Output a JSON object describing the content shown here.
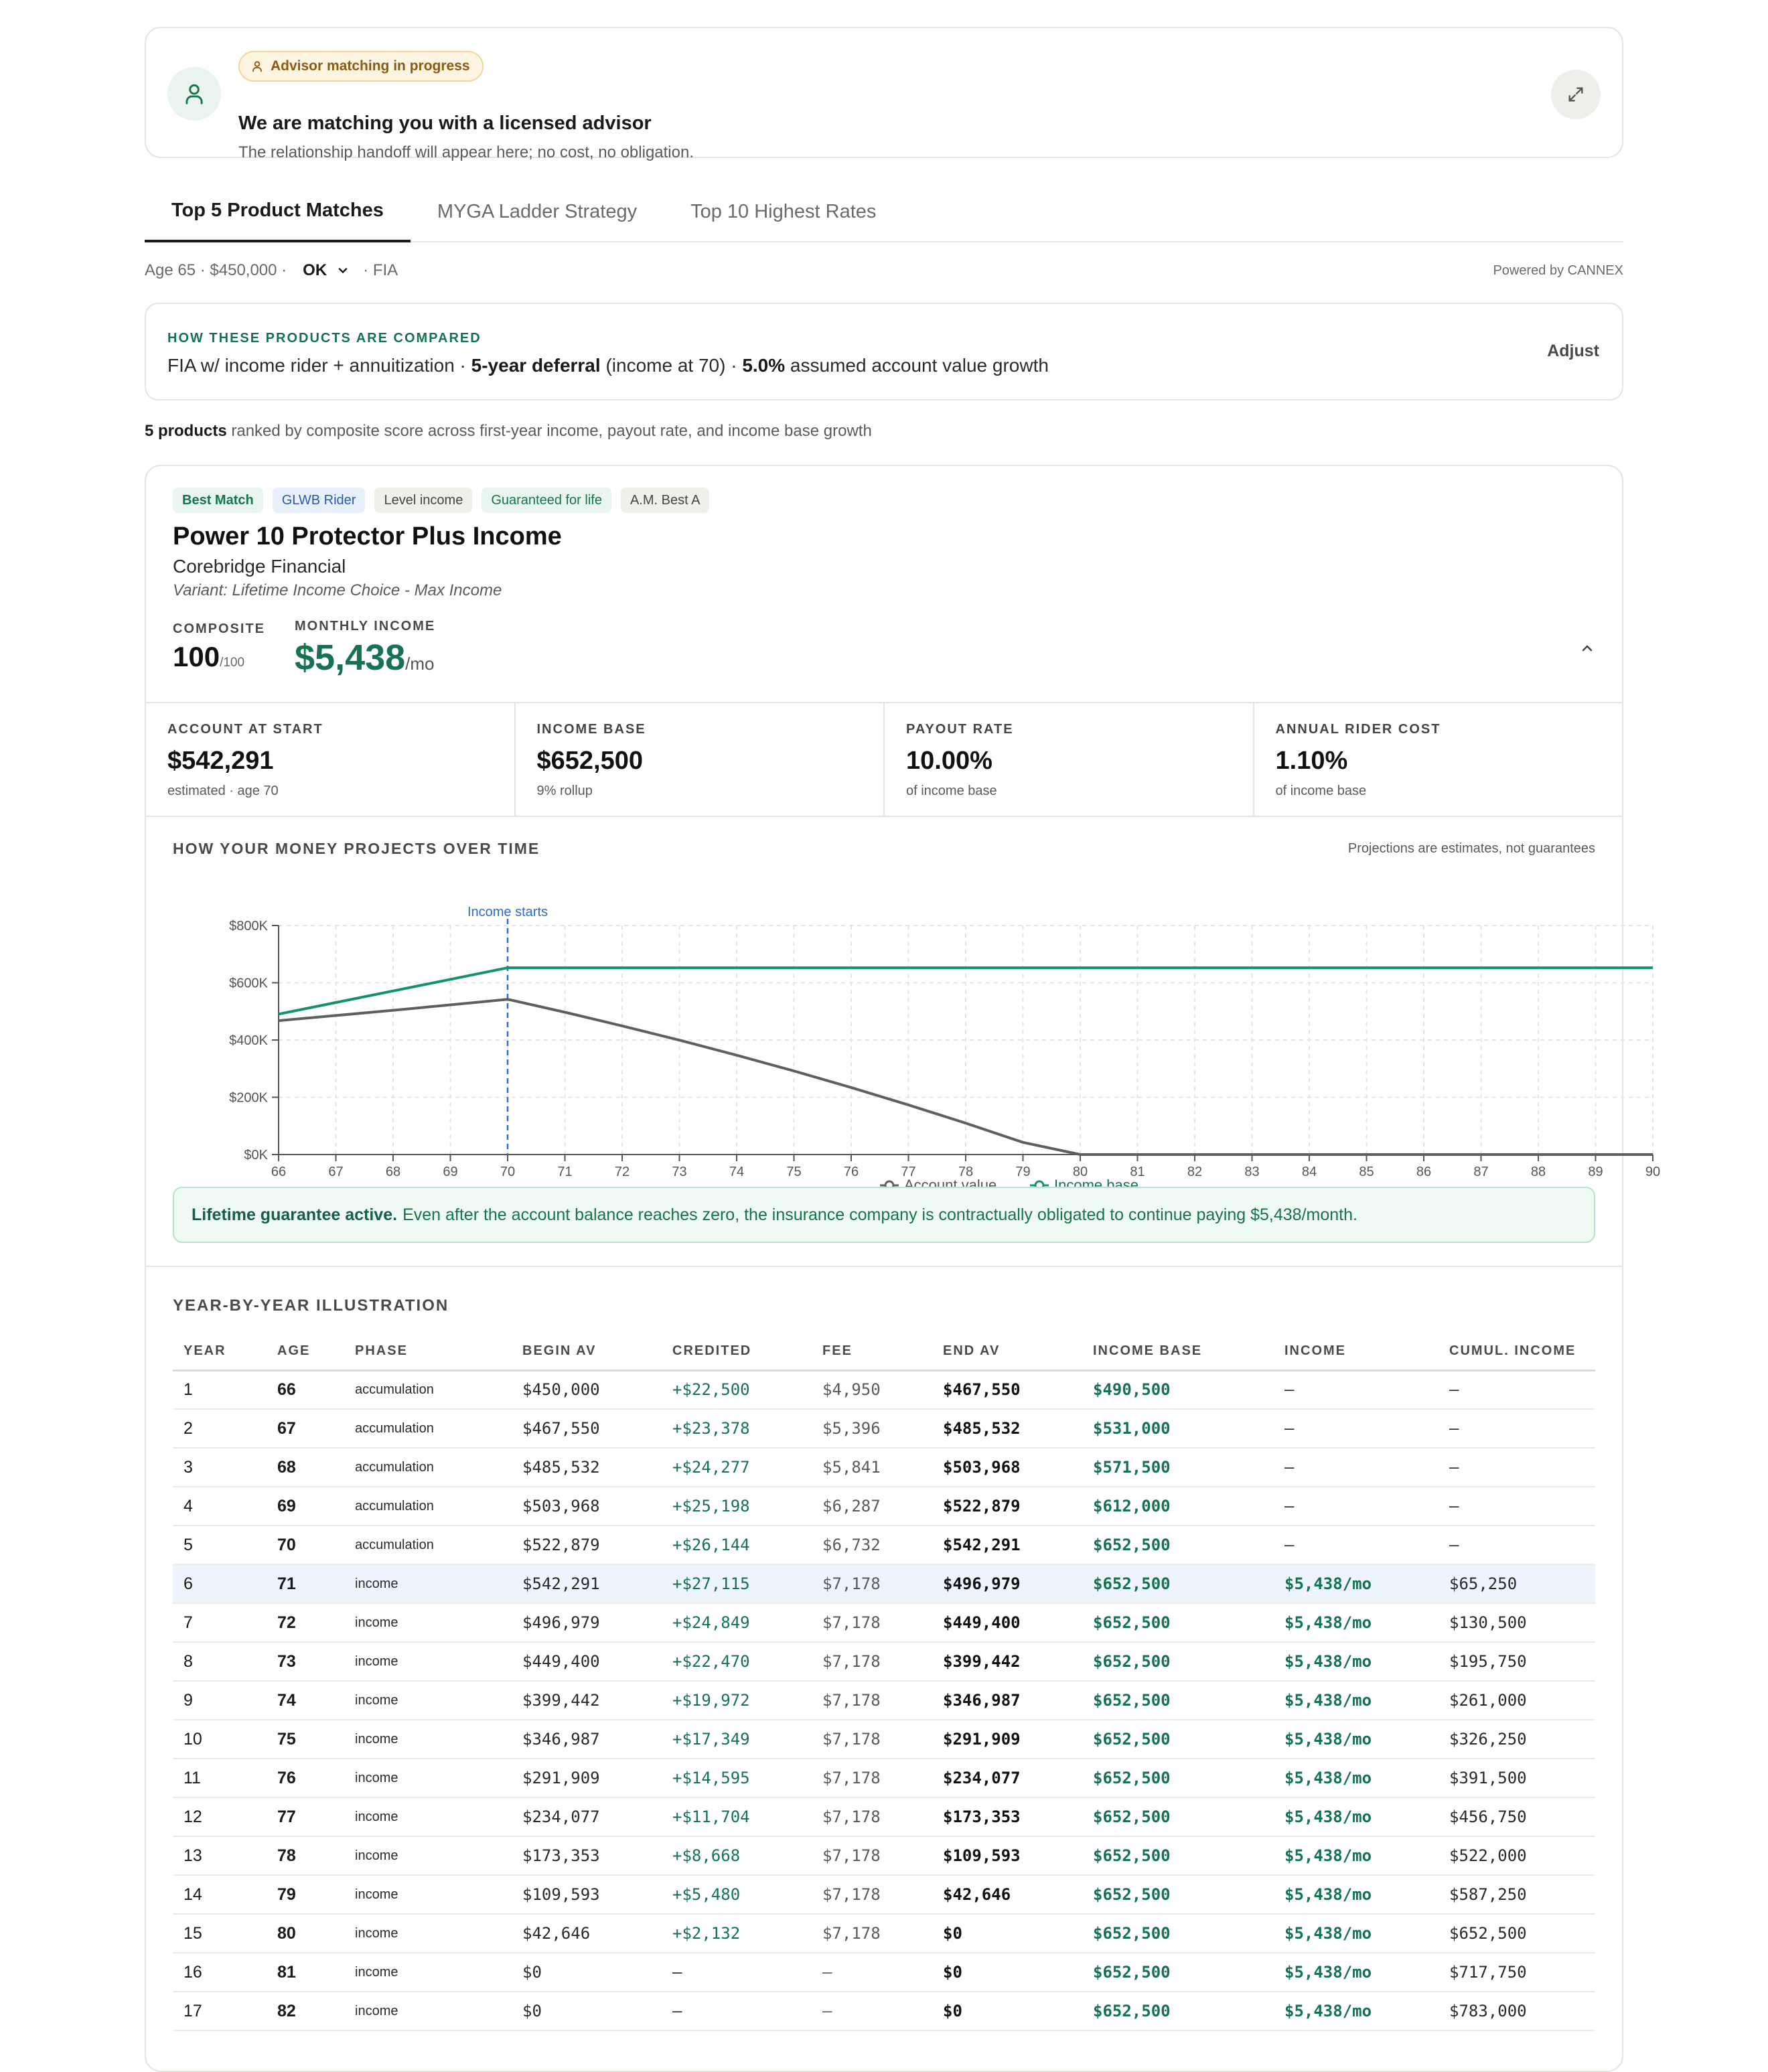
{
  "advisor": {
    "badge": "Advisor matching in progress",
    "title": "We are matching you with a licensed advisor",
    "subtitle": "The relationship handoff will appear here; no cost, no obligation."
  },
  "tabs": [
    {
      "label": "Top 5 Product Matches",
      "active": true
    },
    {
      "label": "MYGA Ladder Strategy",
      "active": false
    },
    {
      "label": "Top 10 Highest Rates",
      "active": false
    }
  ],
  "meta": {
    "prefix": "Age 65 · $450,000 ·",
    "state": "OK",
    "suffix": "· FIA",
    "powered": "Powered by CANNEX"
  },
  "compare": {
    "kicker": "HOW THESE PRODUCTS ARE COMPARED",
    "part1": "FIA w/ income rider + annuitization · ",
    "deferral": "5-year deferral",
    "part2": " (income at 70) · ",
    "growth": "5.0%",
    "part3": " assumed account value growth",
    "adjust": "Adjust"
  },
  "ranked": {
    "count": "5 products",
    "text": " ranked by composite score across first-year income, payout rate, and income base growth"
  },
  "product": {
    "tags": [
      "Best Match",
      "GLWB Rider",
      "Level income",
      "Guaranteed for life",
      "A.M. Best A"
    ],
    "name": "Power 10 Protector Plus Income",
    "company": "Corebridge Financial",
    "variant": "Variant: Lifetime Income Choice - Max Income",
    "composite_label": "COMPOSITE",
    "composite_value": "100",
    "composite_max": "/100",
    "monthly_label": "MONTHLY INCOME",
    "monthly_value": "$5,438",
    "monthly_unit": "/mo"
  },
  "stats": [
    {
      "label": "ACCOUNT AT START",
      "value": "$542,291",
      "sub": "estimated · age 70"
    },
    {
      "label": "INCOME BASE",
      "value": "$652,500",
      "sub": "9% rollup"
    },
    {
      "label": "PAYOUT RATE",
      "value": "10.00%",
      "sub": "of income base"
    },
    {
      "label": "ANNUAL RIDER COST",
      "value": "1.10%",
      "sub": "of income base"
    }
  ],
  "projection": {
    "title": "HOW YOUR MONEY PROJECTS OVER TIME",
    "note": "Projections are estimates, not guarantees"
  },
  "chart_data": {
    "type": "line",
    "x": [
      66,
      67,
      68,
      69,
      70,
      71,
      72,
      73,
      74,
      75,
      76,
      77,
      78,
      79,
      80,
      81,
      82,
      83,
      84,
      85,
      86,
      87,
      88,
      89,
      90
    ],
    "series": [
      {
        "name": "Account value",
        "color": "#5f5f5f",
        "values": [
          467550,
          485532,
          503968,
          522879,
          542291,
          496979,
          449400,
          399442,
          346987,
          291909,
          234077,
          173353,
          109593,
          42646,
          0,
          0,
          0,
          0,
          0,
          0,
          0,
          0,
          0,
          0,
          0
        ]
      },
      {
        "name": "Income base",
        "color": "#14936a",
        "values": [
          490500,
          531000,
          571500,
          612000,
          652500,
          652500,
          652500,
          652500,
          652500,
          652500,
          652500,
          652500,
          652500,
          652500,
          652500,
          652500,
          652500,
          652500,
          652500,
          652500,
          652500,
          652500,
          652500,
          652500,
          652500
        ]
      }
    ],
    "y_ticks": [
      "$0K",
      "$200K",
      "$400K",
      "$600K",
      "$800K"
    ],
    "ylim": [
      0,
      800000
    ],
    "xlim": [
      66,
      90
    ],
    "annotation": {
      "x": 70,
      "label": "Income starts"
    },
    "grid": true,
    "legend": "bottom-center"
  },
  "guarantee": {
    "bold": "Lifetime guarantee active.",
    "text": "Even after the account balance reaches zero, the insurance company is contractually obligated to continue paying $5,438/month."
  },
  "table": {
    "title": "YEAR-BY-YEAR ILLUSTRATION",
    "headers": [
      "YEAR",
      "AGE",
      "PHASE",
      "BEGIN AV",
      "CREDITED",
      "FEE",
      "END AV",
      "INCOME BASE",
      "INCOME",
      "CUMUL. INCOME"
    ],
    "rows": [
      [
        "1",
        "66",
        "accumulation",
        "$450,000",
        "+$22,500",
        "$4,950",
        "$467,550",
        "$490,500",
        "—",
        "—"
      ],
      [
        "2",
        "67",
        "accumulation",
        "$467,550",
        "+$23,378",
        "$5,396",
        "$485,532",
        "$531,000",
        "—",
        "—"
      ],
      [
        "3",
        "68",
        "accumulation",
        "$485,532",
        "+$24,277",
        "$5,841",
        "$503,968",
        "$571,500",
        "—",
        "—"
      ],
      [
        "4",
        "69",
        "accumulation",
        "$503,968",
        "+$25,198",
        "$6,287",
        "$522,879",
        "$612,000",
        "—",
        "—"
      ],
      [
        "5",
        "70",
        "accumulation",
        "$522,879",
        "+$26,144",
        "$6,732",
        "$542,291",
        "$652,500",
        "—",
        "—"
      ],
      [
        "6",
        "71",
        "income",
        "$542,291",
        "+$27,115",
        "$7,178",
        "$496,979",
        "$652,500",
        "$5,438/mo",
        "$65,250"
      ],
      [
        "7",
        "72",
        "income",
        "$496,979",
        "+$24,849",
        "$7,178",
        "$449,400",
        "$652,500",
        "$5,438/mo",
        "$130,500"
      ],
      [
        "8",
        "73",
        "income",
        "$449,400",
        "+$22,470",
        "$7,178",
        "$399,442",
        "$652,500",
        "$5,438/mo",
        "$195,750"
      ],
      [
        "9",
        "74",
        "income",
        "$399,442",
        "+$19,972",
        "$7,178",
        "$346,987",
        "$652,500",
        "$5,438/mo",
        "$261,000"
      ],
      [
        "10",
        "75",
        "income",
        "$346,987",
        "+$17,349",
        "$7,178",
        "$291,909",
        "$652,500",
        "$5,438/mo",
        "$326,250"
      ],
      [
        "11",
        "76",
        "income",
        "$291,909",
        "+$14,595",
        "$7,178",
        "$234,077",
        "$652,500",
        "$5,438/mo",
        "$391,500"
      ],
      [
        "12",
        "77",
        "income",
        "$234,077",
        "+$11,704",
        "$7,178",
        "$173,353",
        "$652,500",
        "$5,438/mo",
        "$456,750"
      ],
      [
        "13",
        "78",
        "income",
        "$173,353",
        "+$8,668",
        "$7,178",
        "$109,593",
        "$652,500",
        "$5,438/mo",
        "$522,000"
      ],
      [
        "14",
        "79",
        "income",
        "$109,593",
        "+$5,480",
        "$7,178",
        "$42,646",
        "$652,500",
        "$5,438/mo",
        "$587,250"
      ],
      [
        "15",
        "80",
        "income",
        "$42,646",
        "+$2,132",
        "$7,178",
        "$0",
        "$652,500",
        "$5,438/mo",
        "$652,500"
      ],
      [
        "16",
        "81",
        "income",
        "$0",
        "—",
        "—",
        "$0",
        "$652,500",
        "$5,438/mo",
        "$717,750"
      ],
      [
        "17",
        "82",
        "income",
        "$0",
        "—",
        "—",
        "$0",
        "$652,500",
        "$5,438/mo",
        "$783,000"
      ]
    ]
  },
  "colors": {
    "accent": "#17734f",
    "line_av": "#5f5f5f",
    "line_ib": "#14936a",
    "marker": "#2b6cd8",
    "highlight": "#eef4fc"
  }
}
